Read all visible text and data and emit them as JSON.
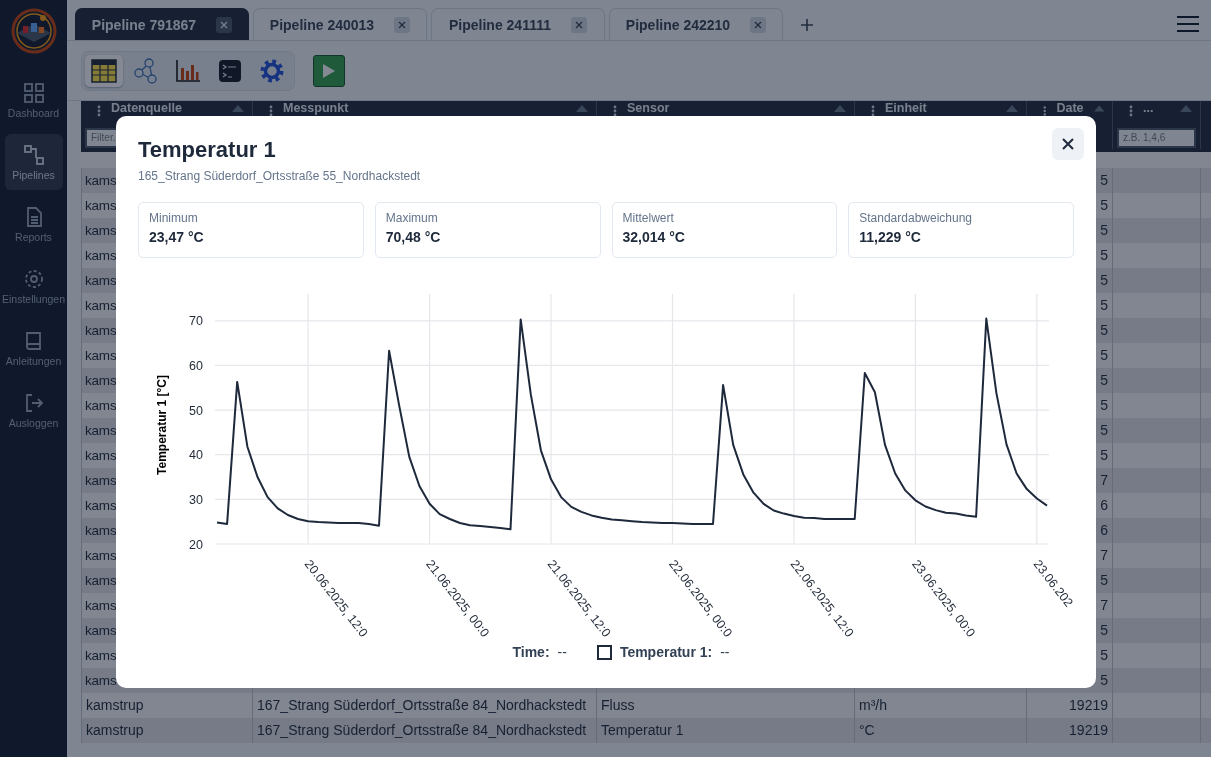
{
  "sidebar": {
    "items": [
      {
        "label": "Dashboard",
        "selected": false
      },
      {
        "label": "Pipelines",
        "selected": true
      },
      {
        "label": "Reports",
        "selected": false
      },
      {
        "label": "Einstellungen",
        "selected": false
      },
      {
        "label": "Anleitungen",
        "selected": false
      },
      {
        "label": "Ausloggen",
        "selected": false
      }
    ]
  },
  "tabs": [
    {
      "label": "Pipeline 791867",
      "selected": true
    },
    {
      "label": "Pipeline 240013",
      "selected": false
    },
    {
      "label": "Pipeline 241111",
      "selected": false
    },
    {
      "label": "Pipeline 242210",
      "selected": false
    }
  ],
  "toolbar": {
    "views": [
      {
        "selected": true
      },
      {
        "selected": false
      },
      {
        "selected": false
      },
      {
        "selected": false
      },
      {
        "selected": false
      }
    ]
  },
  "table": {
    "columns": [
      {
        "label": "Datenquelle",
        "placeholder": "Filter."
      },
      {
        "label": "Messpunkt"
      },
      {
        "label": "Sensor"
      },
      {
        "label": "Einheit"
      },
      {
        "label": "Date"
      },
      {
        "label": "...",
        "placeholder": "z.B. 1,4,6"
      }
    ],
    "rows": [
      [
        "kams",
        null,
        null,
        null,
        "5"
      ],
      [
        "kams",
        null,
        null,
        null,
        "5"
      ],
      [
        "kams",
        null,
        null,
        null,
        "5"
      ],
      [
        "kams",
        null,
        null,
        null,
        "5"
      ],
      [
        "kams",
        null,
        null,
        null,
        "5"
      ],
      [
        "kams",
        null,
        null,
        null,
        "5"
      ],
      [
        "kams",
        null,
        null,
        null,
        "5"
      ],
      [
        "kams",
        null,
        null,
        null,
        "5"
      ],
      [
        "kams",
        null,
        null,
        null,
        "5"
      ],
      [
        "kams",
        null,
        null,
        null,
        "5"
      ],
      [
        "kams",
        null,
        null,
        null,
        "5"
      ],
      [
        "kams",
        null,
        null,
        null,
        "5"
      ],
      [
        "kams",
        null,
        null,
        null,
        "7"
      ],
      [
        "kams",
        null,
        null,
        null,
        "6"
      ],
      [
        "kams",
        null,
        null,
        null,
        "6"
      ],
      [
        "kams",
        null,
        null,
        null,
        "7"
      ],
      [
        "kams",
        null,
        null,
        null,
        "5"
      ],
      [
        "kams",
        null,
        null,
        null,
        "7"
      ],
      [
        "kams",
        null,
        null,
        null,
        "5"
      ],
      [
        "kams",
        null,
        null,
        null,
        "5"
      ],
      [
        "kams",
        null,
        null,
        null,
        "5"
      ],
      [
        "kamstrup",
        "167_Strang Süderdorf_Ortsstraße 84_Nordhackstedt",
        "Fluss",
        "m³/h",
        "19219"
      ],
      [
        "kamstrup",
        "167_Strang Süderdorf_Ortsstraße 84_Nordhackstedt",
        "Temperatur 1",
        "°C",
        "19219"
      ]
    ]
  },
  "modal": {
    "title": "Temperatur 1",
    "subtitle": "165_Strang Süderdorf_Ortsstraße 55_Nordhackstedt",
    "stats": [
      {
        "label": "Minimum",
        "value": "23,47 °C"
      },
      {
        "label": "Maximum",
        "value": "70,48 °C"
      },
      {
        "label": "Mittelwert",
        "value": "32,014 °C"
      },
      {
        "label": "Standardabweichung",
        "value": "11,229 °C"
      }
    ],
    "chart_data": {
      "type": "line",
      "ylabel": "Temperatur 1 [°C]",
      "categories": [
        null,
        null,
        null,
        null,
        null,
        null,
        null,
        null,
        null,
        "20.06.2025, 12:0",
        null,
        null,
        null,
        null,
        null,
        null,
        null,
        null,
        null,
        null,
        null,
        "21.06.2025, 00:0",
        null,
        null,
        null,
        null,
        null,
        null,
        null,
        null,
        null,
        null,
        null,
        "21.06.2025, 12:0",
        null,
        null,
        null,
        null,
        null,
        null,
        null,
        null,
        null,
        null,
        null,
        "22.06.2025, 00:0",
        null,
        null,
        null,
        null,
        null,
        null,
        null,
        null,
        null,
        null,
        null,
        "22.06.2025, 12:0",
        null,
        null,
        null,
        null,
        null,
        null,
        null,
        null,
        null,
        null,
        null,
        "23.06.2025, 00:0",
        null,
        null,
        null,
        null,
        null,
        null,
        null,
        null,
        null,
        null,
        null,
        "23.06.202",
        null
      ],
      "series": [
        {
          "color": "#1e293b",
          "values": [
            24.8,
            24.5,
            56.3,
            41.8,
            35,
            30.5,
            28,
            26.5,
            25.6,
            25.1,
            24.9,
            24.8,
            24.7,
            24.7,
            24.7,
            24.5,
            24.1,
            63.3,
            51,
            39.5,
            33,
            29,
            26.7,
            25.6,
            24.7,
            24.2,
            24,
            23.8,
            23.6,
            23.3,
            70.3,
            53.5,
            41,
            34.5,
            30.5,
            28.3,
            27.2,
            26.4,
            25.9,
            25.5,
            25.3,
            25.1,
            24.9,
            24.8,
            24.7,
            24.7,
            24.6,
            24.5,
            24.5,
            24.5,
            55.6,
            42.2,
            35.6,
            31.5,
            29,
            27.5,
            26.8,
            26.3,
            25.9,
            25.8,
            25.6,
            25.6,
            25.6,
            25.6,
            58.3,
            54,
            42.2,
            35.8,
            32,
            29.8,
            28.4,
            27.6,
            27,
            26.8,
            26.4,
            26.1,
            70.5,
            53.8,
            42.3,
            35.8,
            32.3,
            30.2,
            28.6
          ]
        }
      ],
      "ylim": [
        20,
        76
      ],
      "grid": true,
      "yticks": [
        20,
        30,
        40,
        50,
        60,
        70
      ]
    },
    "legend": {
      "time_label": "Time:",
      "time_value": "--",
      "series_label": "Temperatur 1:",
      "series_value": "--",
      "series_checked": false
    }
  }
}
